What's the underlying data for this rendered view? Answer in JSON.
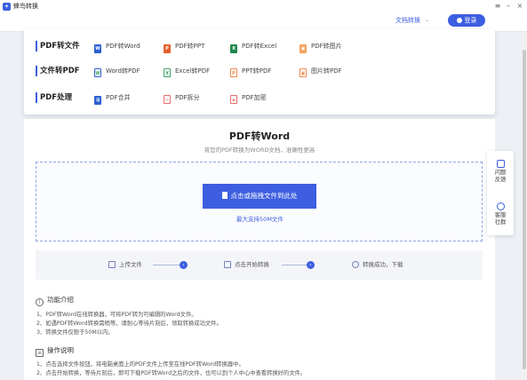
{
  "app": {
    "title": "蜂鸟转换"
  },
  "window_controls": {
    "menu": "≡",
    "minimize": "–",
    "close": "×"
  },
  "header": {
    "doc_nav": "文档转换",
    "doc_nav_arrow": "⌄",
    "login": "登录"
  },
  "menu": {
    "rows": [
      {
        "category": "PDF转文件",
        "tools": [
          {
            "label": "PDF转Word",
            "icon": "word-icon",
            "glyph": "W"
          },
          {
            "label": "PDF转PPT",
            "icon": "ppt-icon",
            "glyph": "P"
          },
          {
            "label": "PDF转Excel",
            "icon": "excel-icon",
            "glyph": "X"
          },
          {
            "label": "PDF转图片",
            "icon": "image-icon",
            "glyph": "▣"
          }
        ]
      },
      {
        "category": "文件转PDF",
        "tools": [
          {
            "label": "Word转PDF",
            "icon": "word-icon",
            "glyph": "W"
          },
          {
            "label": "Excel转PDF",
            "icon": "excel-icon",
            "glyph": "X"
          },
          {
            "label": "PPT转PDF",
            "icon": "ppt-icon",
            "glyph": "P"
          },
          {
            "label": "图片转PDF",
            "icon": "image-icon",
            "glyph": "▣"
          }
        ]
      },
      {
        "category": "PDF处理",
        "tools": [
          {
            "label": "PDF合并",
            "icon": "merge-icon",
            "glyph": "⇶"
          },
          {
            "label": "PDF拆分",
            "icon": "split-icon",
            "glyph": "✂"
          },
          {
            "label": "PDF加密",
            "icon": "lock-icon",
            "glyph": "◈"
          }
        ]
      }
    ]
  },
  "main": {
    "title": "PDF转Word",
    "subtitle": "将您的PDF转换为WORD文档，准确性更高",
    "upload_label": "点击或拖拽文件到此处",
    "size_limit": "最大支持50M文件",
    "steps": [
      "上传文件",
      "点击开始转换",
      "转换成功，下载"
    ],
    "intro": {
      "heading": "功能介绍",
      "lines": [
        "1、PDF转Word在线转换器，可将PDF转为可编辑的Word文件。",
        "2、如遇PDF转Word转换需稍等，请耐心等待片刻后，领取转换成功文件。",
        "3、转换文件仅限于50M以内。"
      ]
    },
    "instructions": {
      "heading": "操作说明",
      "lines": [
        "1、点击选择文件按钮，将电脑桌面上的PDF文件上传至在线PDF转Word转换器中。",
        "2、点击开始转换，等待片刻后，即可下载PDF转Word之后的文件，也可以到个人中心中查看转换好的文件。"
      ]
    }
  },
  "side_float": {
    "feedback": [
      "问题",
      "反馈"
    ],
    "service": [
      "客服",
      "社群"
    ]
  },
  "colors": {
    "accent": "#3d5ee0",
    "word": "#2b5fd0",
    "ppt": "#e2612a",
    "excel": "#20874e",
    "image": "#f4a25a"
  }
}
